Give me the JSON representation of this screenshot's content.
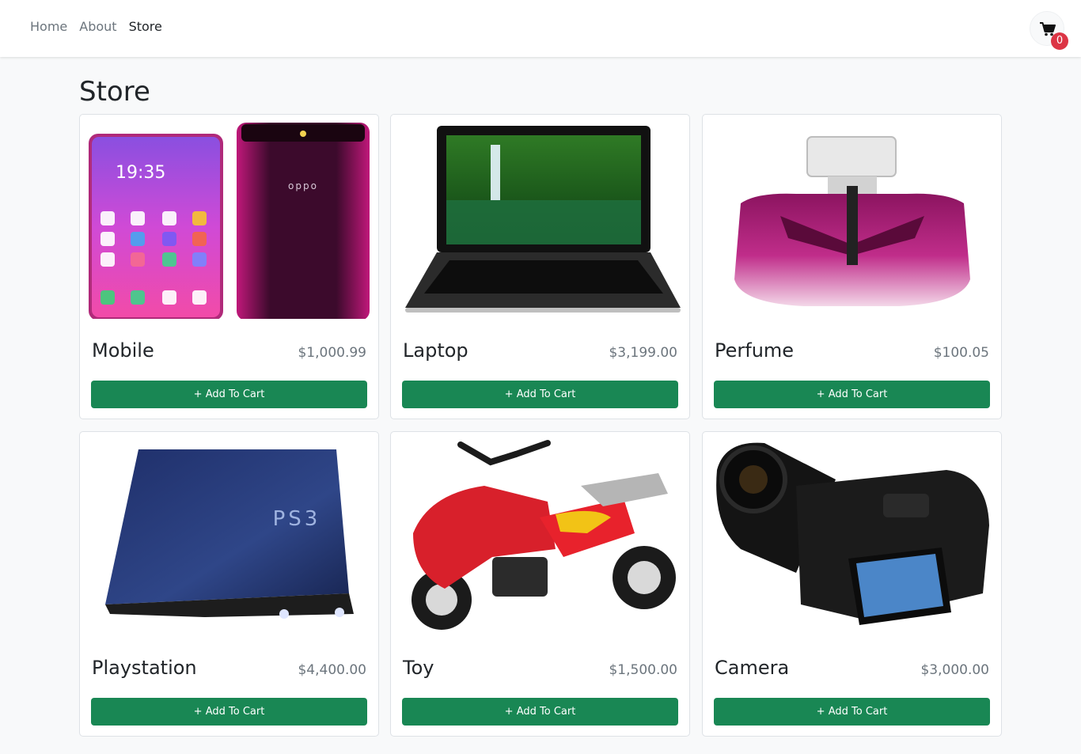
{
  "nav": {
    "links": [
      {
        "label": "Home",
        "active": false
      },
      {
        "label": "About",
        "active": false
      },
      {
        "label": "Store",
        "active": true
      }
    ],
    "cart_count": "0",
    "cart_icon": "shopping-cart-icon"
  },
  "page": {
    "title": "Store"
  },
  "products": [
    {
      "name": "Mobile",
      "price": "$1,000.99",
      "button_label": "+ Add To Cart",
      "image": "mobile-phone-image"
    },
    {
      "name": "Laptop",
      "price": "$3,199.00",
      "button_label": "+ Add To Cart",
      "image": "laptop-image"
    },
    {
      "name": "Perfume",
      "price": "$100.05",
      "button_label": "+ Add To Cart",
      "image": "perfume-bottle-image"
    },
    {
      "name": "Playstation",
      "price": "$4,400.00",
      "button_label": "+ Add To Cart",
      "image": "playstation-console-image"
    },
    {
      "name": "Toy",
      "price": "$1,500.00",
      "button_label": "+ Add To Cart",
      "image": "toy-motorbike-image"
    },
    {
      "name": "Camera",
      "price": "$3,000.00",
      "button_label": "+ Add To Cart",
      "image": "dslr-camera-image"
    }
  ],
  "colors": {
    "accent": "#198754",
    "badge": "#dc3545"
  }
}
